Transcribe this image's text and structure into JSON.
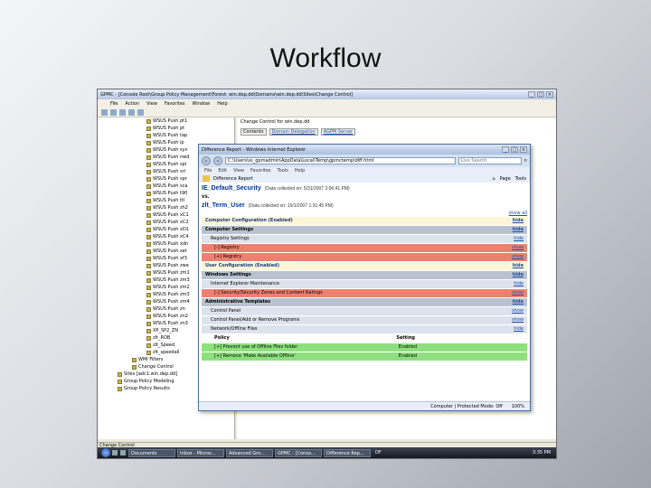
{
  "slide": {
    "title": "Workflow"
  },
  "gpmc": {
    "title": "GPMC - [Console Root\\Group Policy Management\\Forest: win.dep.dd\\Domains\\win.dep.dd\\Sites\\Change Control]",
    "menu": [
      "File",
      "Action",
      "View",
      "Favorites",
      "Window",
      "Help"
    ],
    "tree": [
      "WSUS Push pt1",
      "WSUS Push pt",
      "WSUS Push tap",
      "WSUS Push ip",
      "WSUS Push sys",
      "WSUS Push nwd",
      "WSUS Push spl",
      "WSUS Push srl",
      "WSUS Push spr",
      "WSUS Push sca",
      "WSUS Push t90",
      "WSUS Push ttl",
      "WSUS Push zh2",
      "WSUS Push xC1",
      "WSUS Push xC2",
      "WSUS Push xD1",
      "WSUS Push xC4",
      "WSUS Push xdn",
      "WSUS Push xet",
      "WSUS Push xf3",
      "WSUS Push zwe",
      "WSUS Push zm1",
      "WSUS Push zm3",
      "WSUS Push zm2",
      "WSUS Push zm3",
      "WSUS Push zm4",
      "WSUS Push zn",
      "WSUS Push zn2",
      "WSUS Push zn3",
      "XP_SP2_ZN",
      "zlt_ROB",
      "zlt_Speed",
      "zlt_speedall",
      "WMI Filters",
      "Change Control",
      "Sites [adc1.win.dep.dd]",
      "Group Policy Modeling",
      "Group Policy Results"
    ],
    "right_header": "Change Control for win.dep.dd",
    "right_tabs": [
      "Contents",
      "Domain Delegation",
      "AGPM Server"
    ],
    "statusbar": "Change Control",
    "taskbar": [
      "Documents",
      "Inbox - Micros...",
      "Advanced Gro...",
      "GPMC - [Conso...",
      "Difference Rep..."
    ],
    "tray": "DF",
    "clock": "3:35 PM"
  },
  "ie": {
    "title": "Difference Report - Windows Internet Explorer",
    "url": "C:\\Users\\ss_gpmadmin\\AppData\\Local\\Temp\\gpmctemp\\diff.html",
    "search_placeholder": "Live Search",
    "menu": [
      "File",
      "Edit",
      "View",
      "Favorites",
      "Tools",
      "Help"
    ],
    "tab": "Difference Report",
    "tools": [
      "Page",
      "Tools"
    ],
    "status_text": "Computer | Protected Mode: Off",
    "zoom": "100%",
    "report": {
      "gpo_a": "IE_Default_Security",
      "gpo_a_meta": "(Data collected on: 5/31/2007 2:06:41 PM)",
      "vs": "vs.",
      "gpo_b": "zlt_Term_User",
      "gpo_b_meta": "(Data collected on: 10/1/2007 1:31:45 PM)",
      "show_all": "show all",
      "sections": [
        {
          "kind": "cfg",
          "label": "Computer Configuration (Enabled)",
          "link": "hide"
        },
        {
          "kind": "gray",
          "label": "Computer Settings",
          "link": "hide"
        },
        {
          "kind": "sub",
          "label": "Registry Settings",
          "link": "hide"
        },
        {
          "kind": "red",
          "label": "[-] Registry",
          "link": "show"
        },
        {
          "kind": "red",
          "label": "[+] Registry",
          "link": "show"
        },
        {
          "kind": "cfg",
          "label": "User Configuration (Enabled)",
          "link": "hide"
        },
        {
          "kind": "gray",
          "label": "Windows Settings",
          "link": "hide"
        },
        {
          "kind": "sub",
          "label": "Internet Explorer Maintenance",
          "link": "hide"
        },
        {
          "kind": "red",
          "label": "[-] Security/Security Zones and Content Ratings",
          "link": "show"
        },
        {
          "kind": "gray",
          "label": "Administrative Templates",
          "link": "hide"
        },
        {
          "kind": "sub",
          "label": "Control Panel",
          "link": "show"
        },
        {
          "kind": "sub",
          "label": "Control Panel/Add or Remove Programs",
          "link": "show"
        },
        {
          "kind": "sub",
          "label": "Network/Offline Files",
          "link": "hide"
        }
      ],
      "policy_header": {
        "col1": "Policy",
        "col2": "Setting"
      },
      "policies": [
        {
          "name": "[+] Prevent use of Offline Files folder",
          "setting": "Enabled"
        },
        {
          "name": "[+] Remove 'Make Available Offline'",
          "setting": "Enabled"
        }
      ]
    }
  }
}
